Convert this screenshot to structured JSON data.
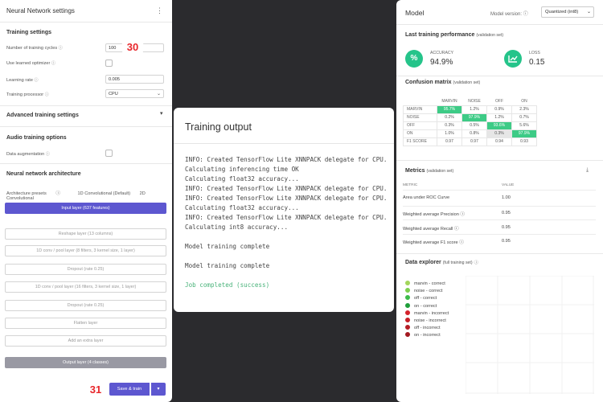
{
  "left_panel": {
    "title": "Neural Network settings",
    "menu_icon": "more-vertical-icon",
    "training_settings": {
      "heading": "Training settings",
      "cycles_label": "Number of training cycles",
      "cycles_value": "100",
      "learned_optimizer_label": "Use learned optimizer",
      "learning_rate_label": "Learning rate",
      "learning_rate_value": "0.005",
      "processor_label": "Training processor",
      "processor_value": "CPU"
    },
    "advanced_heading": "Advanced training settings",
    "audio": {
      "heading": "Audio training options",
      "augmentation_label": "Data augmentation"
    },
    "architecture": {
      "heading": "Neural network architecture",
      "presets_label": "Architecture presets",
      "preset_1d": "1D Convolutional (Default)",
      "preset_2d": "2D Convolutional"
    },
    "layers": [
      "Input layer (637 features)",
      "Reshape layer (13 columns)",
      "1D conv / pool layer (8 filters, 3 kernel size, 1 layer)",
      "Dropout (rate 0.25)",
      "1D conv / pool layer (16 filters, 3 kernel size, 1 layer)",
      "Dropout (rate 0.25)",
      "Flatten layer",
      "Add an extra layer",
      "Output layer (4 classes)"
    ],
    "save_button": "Save & train",
    "callout_30": "30",
    "callout_31": "31"
  },
  "training_output": {
    "title": "Training output",
    "log_lines": [
      "INFO: Created TensorFlow Lite XNNPACK delegate for CPU.",
      "Calculating inferencing time OK",
      "Calculating float32 accuracy...",
      "INFO: Created TensorFlow Lite XNNPACK delegate for CPU.",
      "INFO: Created TensorFlow Lite XNNPACK delegate for CPU.",
      "Calculating float32 accuracy...",
      "INFO: Created TensorFlow Lite XNNPACK delegate for CPU.",
      "Calculating int8 accuracy..."
    ],
    "complete_1": "Model training complete",
    "complete_2": "Model training complete",
    "job_status": "Job completed (success)"
  },
  "model_panel": {
    "title": "Model",
    "version_label": "Model version:",
    "version_value": "Quantized (int8)",
    "last_perf_heading": "Last training performance",
    "last_perf_sub": "(validation set)",
    "accuracy_label": "ACCURACY",
    "accuracy_value": "94.9%",
    "loss_label": "LOSS",
    "loss_value": "0.15",
    "confusion_heading": "Confusion matrix",
    "confusion_sub": "(validation set)",
    "confusion": {
      "columns": [
        "MARVIN",
        "NOISE",
        "OFF",
        "ON"
      ],
      "rows": [
        {
          "label": "MARVIN",
          "cells": [
            "95.7%",
            "1.2%",
            "0.9%",
            "2.3%"
          ]
        },
        {
          "label": "NOISE",
          "cells": [
            "0.2%",
            "97.9%",
            "1.2%",
            "0.7%"
          ]
        },
        {
          "label": "OFF",
          "cells": [
            "0.3%",
            "0.5%",
            "93.6%",
            "5.6%"
          ]
        },
        {
          "label": "ON",
          "cells": [
            "1.0%",
            "0.8%",
            "0.3%",
            "97.9%"
          ]
        },
        {
          "label": "F1 SCORE",
          "cells": [
            "0.97",
            "0.97",
            "0.94",
            "0.93"
          ]
        }
      ]
    },
    "metrics_heading": "Metrics",
    "metrics_sub": "(validation set)",
    "metrics_col_metric": "METRIC",
    "metrics_col_value": "VALUE",
    "metrics": [
      {
        "name": "Area under ROC Curve",
        "value": "1.00"
      },
      {
        "name": "Weighted average Precision",
        "value": "0.95"
      },
      {
        "name": "Weighted average Recall",
        "value": "0.95"
      },
      {
        "name": "Weighted average F1 score",
        "value": "0.95"
      }
    ],
    "explorer_heading": "Data explorer",
    "explorer_sub": "(full training set)",
    "legend": [
      {
        "label": "marvin - correct",
        "color": "#a3d65c"
      },
      {
        "label": "noise - correct",
        "color": "#7ccf4f"
      },
      {
        "label": "off - correct",
        "color": "#3dbb4a"
      },
      {
        "label": "on - correct",
        "color": "#1f9e3a"
      },
      {
        "label": "marvin - incorrect",
        "color": "#d4222b"
      },
      {
        "label": "noise - incorrect",
        "color": "#c61f27"
      },
      {
        "label": "off - incorrect",
        "color": "#b51c24"
      },
      {
        "label": "on - incorrect",
        "color": "#a31920"
      }
    ]
  }
}
